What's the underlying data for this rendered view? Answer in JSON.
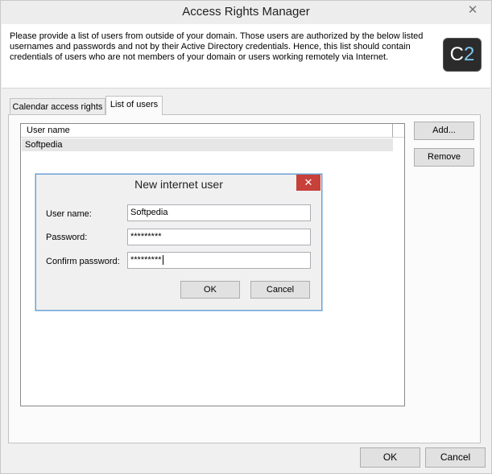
{
  "window": {
    "title": "Access Rights Manager",
    "close_glyph": "✕"
  },
  "info": {
    "text": "Please provide a list of users from outside of your domain. Those users are authorized by the below listed usernames and passwords and not by their Active Directory credentials. Hence, this list should contain credentials of users who are not members of your domain or users working remotely via Internet.",
    "logo_c": "C",
    "logo_2": "2"
  },
  "tabs": [
    {
      "label": "Calendar access rights",
      "active": false
    },
    {
      "label": "List of users",
      "active": true
    }
  ],
  "users_list": {
    "column_header": "User name",
    "rows": [
      "Softpedia"
    ]
  },
  "side_buttons": {
    "add": "Add...",
    "remove": "Remove"
  },
  "footer_buttons": {
    "ok": "OK",
    "cancel": "Cancel"
  },
  "dialog": {
    "title": "New internet user",
    "close_glyph": "✕",
    "close_color": "#c7403a",
    "user_name_label": "User name:",
    "user_name_value": "Softpedia",
    "password_label": "Password:",
    "password_value": "*********",
    "confirm_label": "Confirm password:",
    "confirm_value": "*********",
    "ok": "OK",
    "cancel": "Cancel"
  }
}
